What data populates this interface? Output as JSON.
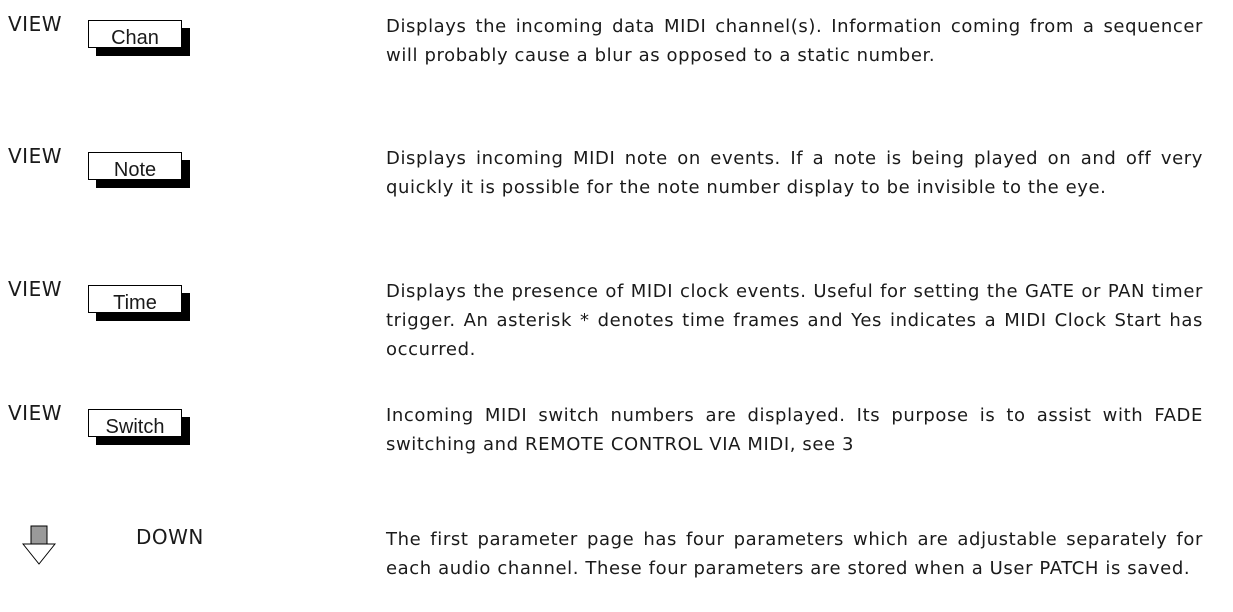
{
  "rows": [
    {
      "view_label": "VIEW",
      "display": "Chan",
      "description": "Displays the incoming data MIDI channel(s). Information coming from a sequencer will probably cause a blur as opposed to a static number."
    },
    {
      "view_label": "VIEW",
      "display": "Note",
      "description": "Displays incoming MIDI note on events. If a note is being played on and off very quickly it is possible for the note number display to be invisible to the eye."
    },
    {
      "view_label": "VIEW",
      "display": "Time",
      "description": "Displays the presence of MIDI clock events. Useful for setting the GATE or PAN timer trigger. An asterisk * denotes time frames and Yes indicates a MIDI Clock Start has occurred."
    },
    {
      "view_label": "VIEW",
      "display": "Switch",
      "description": "Incoming MIDI switch numbers are displayed. Its purpose is to assist with FADE switching and REMOTE CONTROL VIA MIDI, see 3"
    }
  ],
  "down": {
    "icon": "down-arrow-icon",
    "label": "DOWN",
    "description": "The first parameter page has four parameters which are adjustable separately for each audio channel. These four parameters are stored when a User PATCH is saved."
  }
}
